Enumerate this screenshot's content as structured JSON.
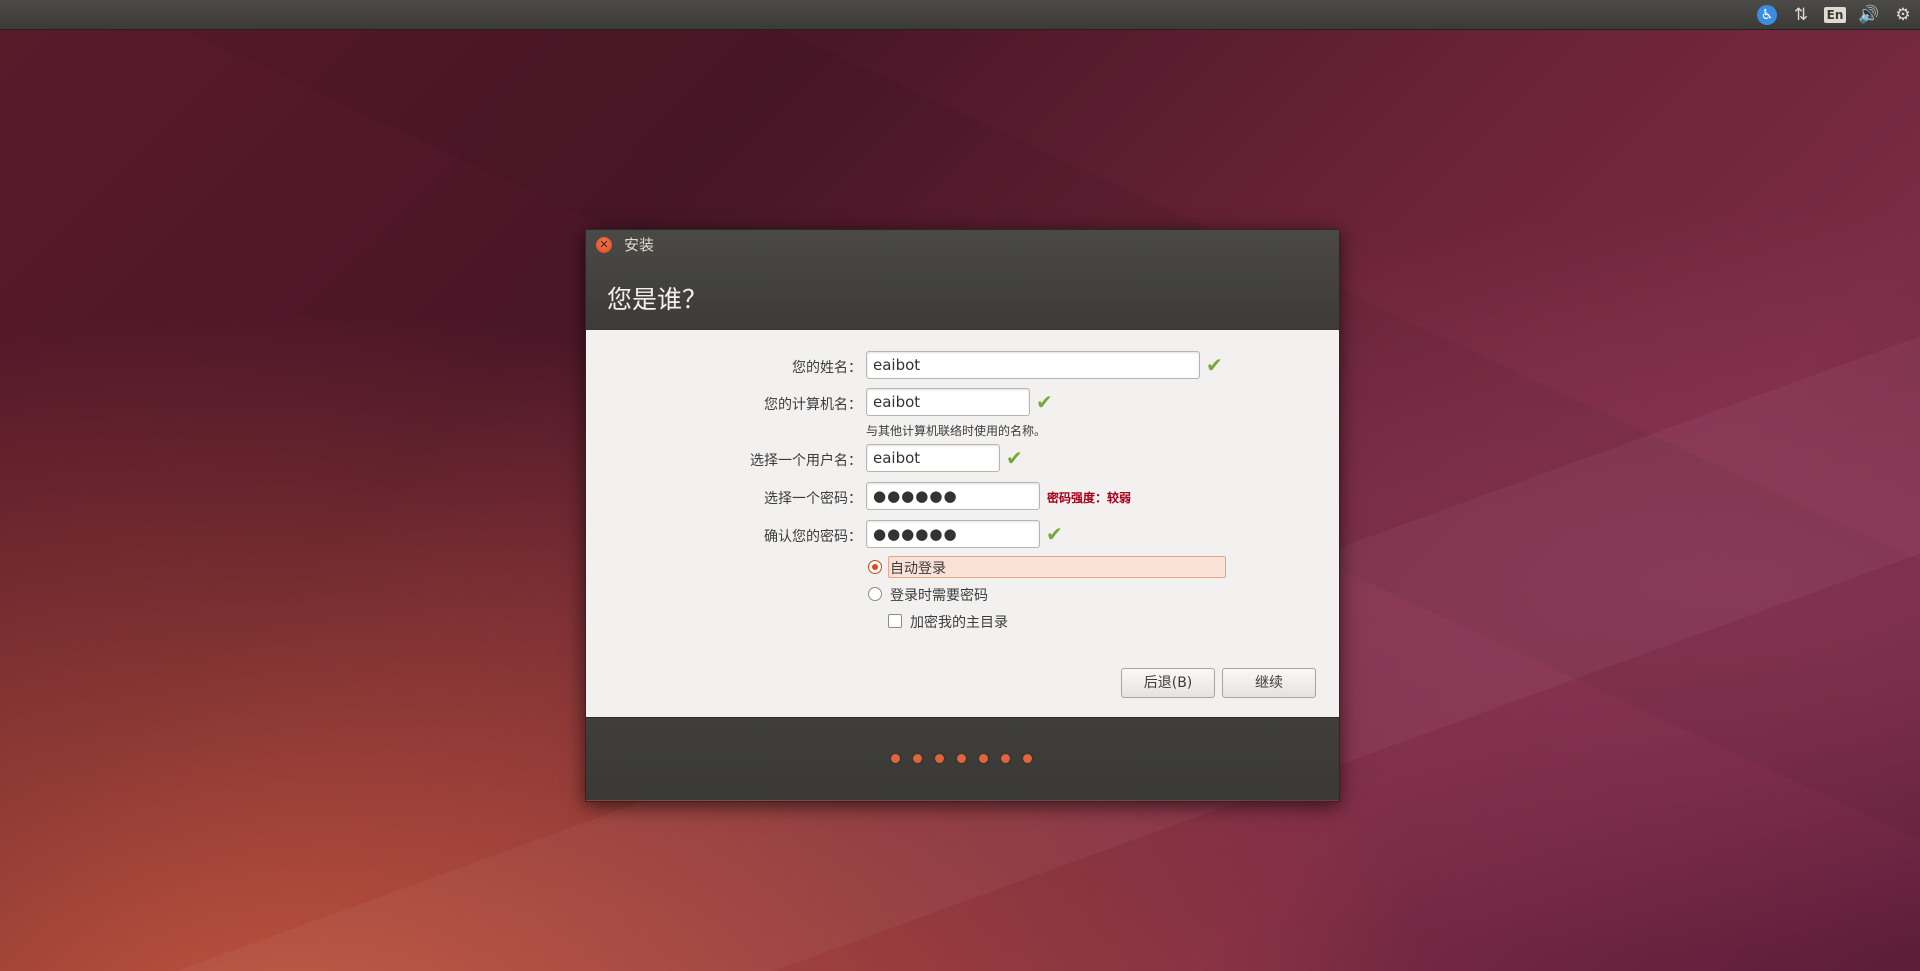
{
  "tray": {
    "items": [
      {
        "name": "accessibility-icon",
        "glyph": "♿"
      },
      {
        "name": "network-icon",
        "glyph": "⇅"
      },
      {
        "name": "keyboard-layout-icon",
        "glyph": "En"
      },
      {
        "name": "volume-icon",
        "glyph": "🔊"
      },
      {
        "name": "gear-icon",
        "glyph": "⚙"
      }
    ]
  },
  "window": {
    "title": "安装",
    "page_title": "您是谁？",
    "close_glyph": "✕"
  },
  "form": {
    "name_label": "您的姓名：",
    "name_value": "eaibot",
    "computer_label": "您的计算机名：",
    "computer_value": "eaibot",
    "computer_hint": "与其他计算机联络时使用的名称。",
    "username_label": "选择一个用户名：",
    "username_value": "eaibot",
    "password_label": "选择一个密码：",
    "password_value": "●●●●●●",
    "password_strength": "密码强度：较弱",
    "confirm_label": "确认您的密码：",
    "confirm_value": "●●●●●●",
    "check_glyph": "✔",
    "auto_login_label": "自动登录",
    "require_password_label": "登录时需要密码",
    "encrypt_home_label": "加密我的主目录"
  },
  "buttons": {
    "back_label": "后退(B)",
    "continue_label": "继续"
  },
  "progress": {
    "step_count": 7
  },
  "colors": {
    "accent": "#dd4814",
    "check_green": "#75a93b",
    "weak_red": "#a5001a"
  }
}
